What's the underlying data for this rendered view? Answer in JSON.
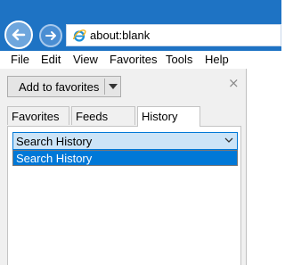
{
  "colors": {
    "titlebar": "#1e73c4",
    "selection": "#0078d7",
    "select_fill": "#cce4f7",
    "pane_bg": "#f0f0f0"
  },
  "navigation": {
    "back_icon": "back-arrow-icon",
    "forward_icon": "forward-arrow-icon",
    "address_icon": "internet-explorer-icon",
    "address": "about:blank"
  },
  "menu": {
    "items": [
      "File",
      "Edit",
      "View",
      "Favorites",
      "Tools",
      "Help"
    ]
  },
  "favorites_center": {
    "add_button_label": "Add to favorites",
    "add_button_arrow_icon": "chevron-down-icon",
    "close_icon": "close-icon",
    "close_glyph": "×",
    "tabs": [
      {
        "label": "Favorites",
        "active": false
      },
      {
        "label": "Feeds",
        "active": false
      },
      {
        "label": "History",
        "active": true
      }
    ],
    "history_view": {
      "selected": "Search History",
      "options": [
        "Search History"
      ]
    }
  }
}
